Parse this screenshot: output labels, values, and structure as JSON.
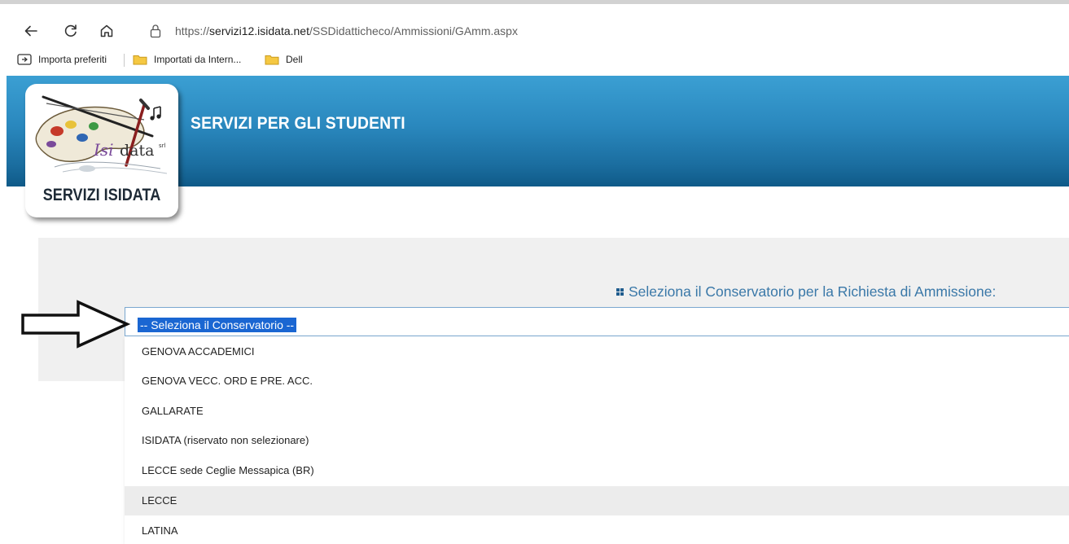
{
  "browser": {
    "url_prefix": "https://",
    "url_host": "servizi12.isidata.net",
    "url_path": "/SSDidatticheco/Ammissioni/GAmm.aspx",
    "bookmarks": [
      {
        "label": "Importa preferiti",
        "icon": "import-favorites-icon"
      },
      {
        "label": "Importati da Intern...",
        "icon": "folder-icon"
      },
      {
        "label": "Dell",
        "icon": "folder-icon"
      }
    ]
  },
  "header": {
    "title": "SERVIZI PER GLI STUDENTI",
    "logo_caption": "SERVIZI ISIDATA",
    "logo_wordmark_a": "Isi",
    "logo_wordmark_b": "data",
    "logo_wordmark_sup": "srl"
  },
  "form": {
    "section_label": "Seleziona il Conservatorio per la Richiesta di Ammissione:",
    "select_value": "-- Seleziona il Conservatorio --",
    "options": [
      "GENOVA ACCADEMICI",
      "GENOVA VECC. ORD E PRE. ACC.",
      "GALLARATE",
      "ISIDATA (riservato non selezionare)",
      "LECCE sede Ceglie Messapica (BR)",
      "LECCE",
      "LATINA"
    ],
    "hovered_option": "LECCE"
  },
  "colors": {
    "header_blue": "#2a88be",
    "selection_blue": "#1a66d2",
    "label_blue": "#3a78a8"
  }
}
